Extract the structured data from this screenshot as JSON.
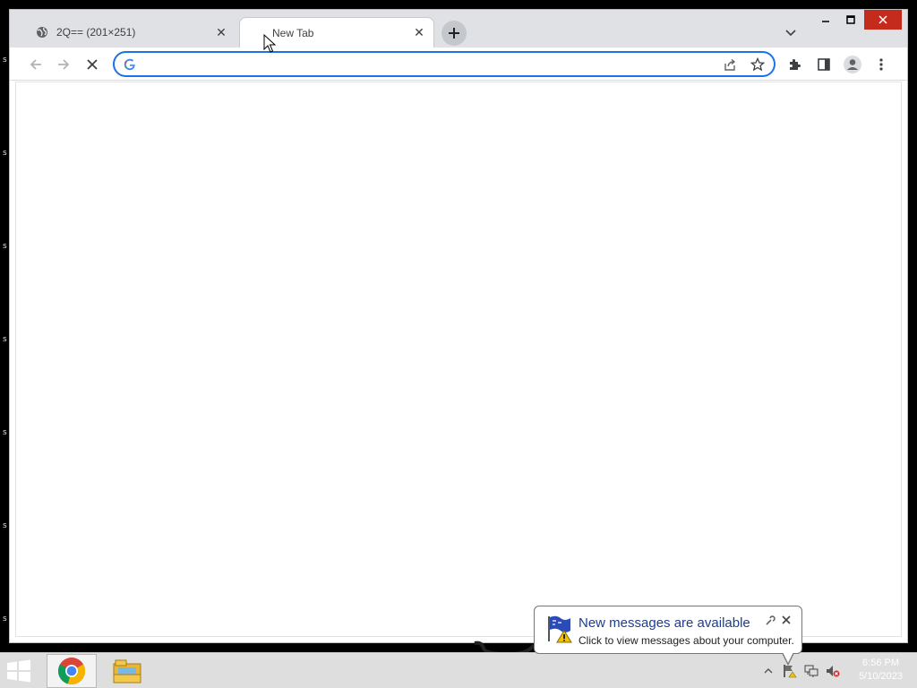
{
  "desktop": {
    "edge_glyph": "s"
  },
  "browser": {
    "tabs": [
      {
        "title": "2Q== (201×251)",
        "favicon": "globe-icon",
        "active": false
      },
      {
        "title": "New Tab",
        "favicon": "blank",
        "active": true
      }
    ],
    "omnibox": {
      "value": "",
      "placeholder": ""
    },
    "toolbar_icons": [
      "back-icon",
      "forward-icon",
      "stop-icon",
      "share-icon",
      "star-icon",
      "extensions-icon",
      "side-panel-icon",
      "profile-icon",
      "menu-icon"
    ]
  },
  "notification": {
    "title": "New messages are available",
    "text": "Click to view messages about your computer."
  },
  "taskbar": {
    "items": [
      "chrome-icon",
      "file-explorer-icon"
    ],
    "clock": {
      "time": "6:56 PM",
      "date": "5/10/2023"
    }
  },
  "colors": {
    "accent": "#1a73e8",
    "close_red": "#c42b1c",
    "tabstrip": "#dfe1e5"
  }
}
